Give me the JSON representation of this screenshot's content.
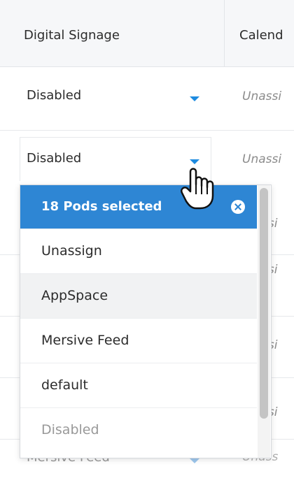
{
  "header": {
    "col_digital_signage": "Digital Signage",
    "col_calendar": "Calend"
  },
  "rows": [
    {
      "value": "Disabled",
      "calendar": "Unassi"
    },
    {
      "value": "Disabled",
      "calendar": "Unassi"
    },
    {
      "calendar": "ssi"
    },
    {
      "calendar": "ssi"
    },
    {
      "calendar": "ssi"
    },
    {
      "calendar": "ssi"
    },
    {
      "value": "Mersive Feed",
      "calendar": "Unass"
    }
  ],
  "dropdown": {
    "header": "18 Pods selected",
    "options": [
      "Unassign",
      "AppSpace",
      "Mersive Feed",
      "default",
      "Disabled"
    ]
  },
  "icons": {
    "caret": "caret-down-icon",
    "clear": "clear-circle-icon",
    "cursor": "hand-pointer-icon"
  },
  "colors": {
    "accent": "#2e86d4",
    "caret": "#1e8be0"
  }
}
